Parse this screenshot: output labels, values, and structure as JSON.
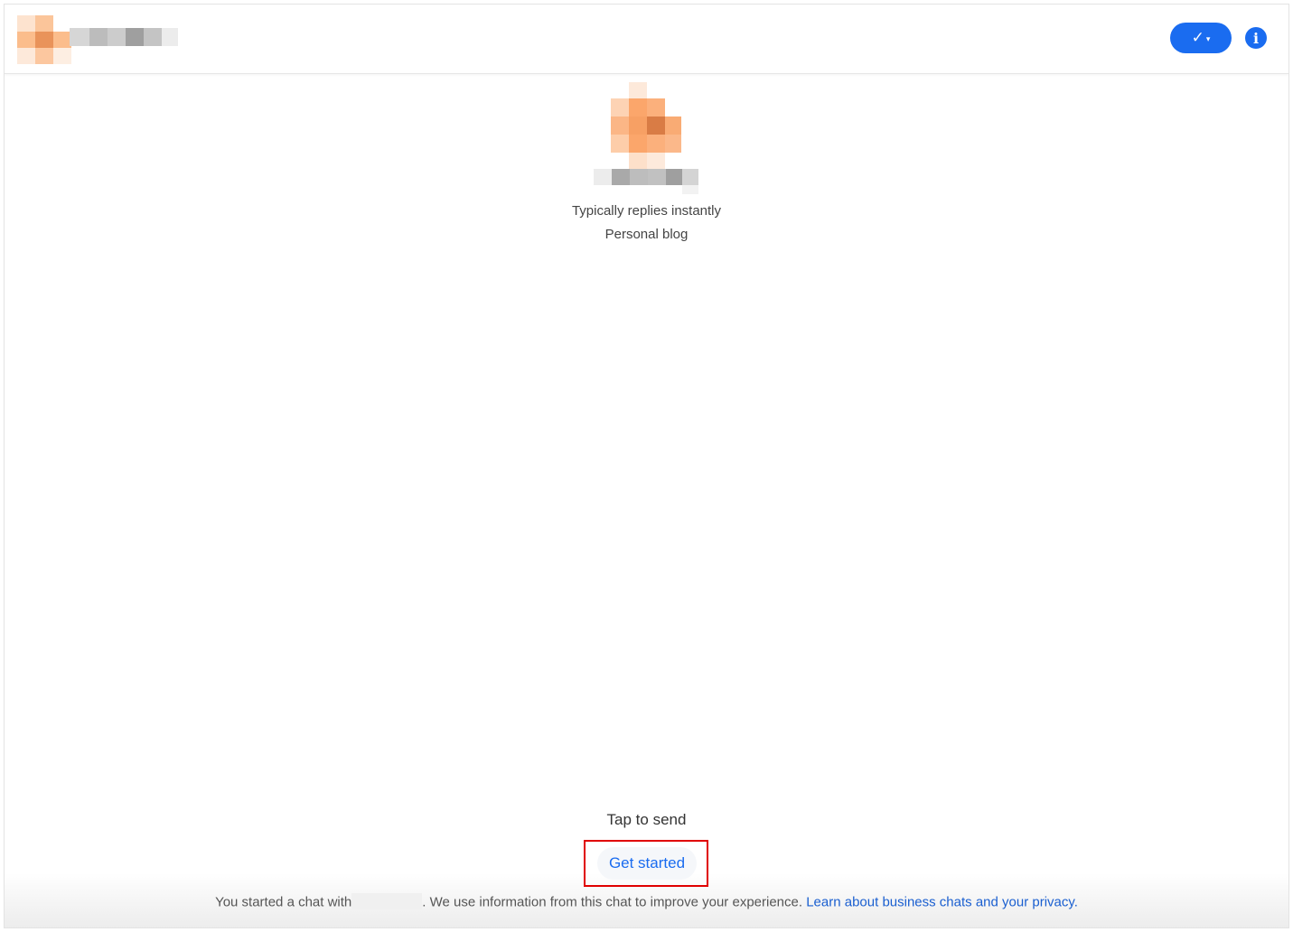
{
  "header": {
    "business_logo_icon": "pixelated-logo-icon",
    "business_name": "",
    "actions": {
      "mark_read_icon": "checkmark-dropdown-icon",
      "check_glyph": "✓",
      "caret_glyph": "▾",
      "info_icon": "info-circle-icon",
      "info_glyph": "i"
    },
    "accent_color": "#1a6cf0"
  },
  "profile": {
    "avatar_icon": "pixelated-avatar-icon",
    "reply_status": "Typically replies instantly",
    "category": "Personal blog"
  },
  "composer": {
    "hint": "Tap to send",
    "quick_reply_label": "Get started",
    "highlight_color": "#e00000"
  },
  "footer": {
    "prefix": "You started a chat with",
    "middle": ". We use information from this chat to improve your experience. ",
    "link_text": "Learn about business chats and your privacy."
  }
}
